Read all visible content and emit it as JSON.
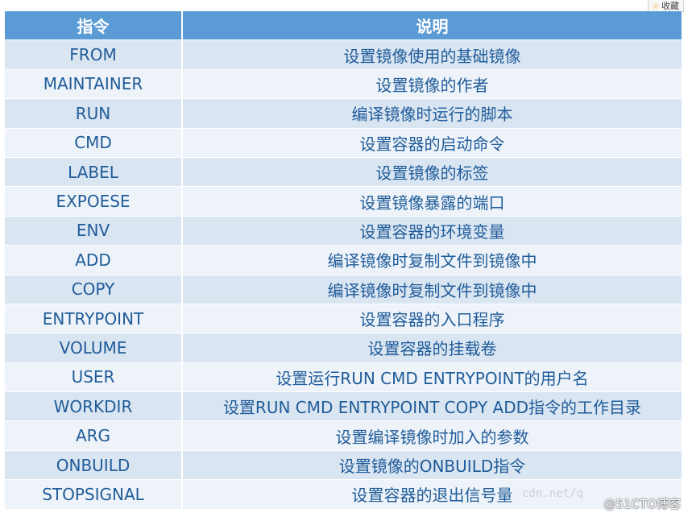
{
  "favorite": {
    "label": "收藏",
    "icon": "star-icon"
  },
  "table": {
    "headers": [
      "指令",
      "说明"
    ],
    "rows": [
      [
        "FROM",
        "设置镜像使用的基础镜像"
      ],
      [
        "MAINTAINER",
        "设置镜像的作者"
      ],
      [
        "RUN",
        "编译镜像时运行的脚本"
      ],
      [
        "CMD",
        "设置容器的启动命令"
      ],
      [
        "LABEL",
        "设置镜像的标签"
      ],
      [
        "EXPOESE",
        "设置镜像暴露的端口"
      ],
      [
        "ENV",
        "设置容器的环境变量"
      ],
      [
        "ADD",
        "编译镜像时复制文件到镜像中"
      ],
      [
        "COPY",
        "编译镜像时复制文件到镜像中"
      ],
      [
        "ENTRYPOINT",
        "设置容器的入口程序"
      ],
      [
        "VOLUME",
        "设置容器的挂载卷"
      ],
      [
        "USER",
        "设置运行RUN CMD ENTRYPOINT的用户名"
      ],
      [
        "WORKDIR",
        "设置RUN CMD ENTRYPOINT COPY ADD指令的工作目录"
      ],
      [
        "ARG",
        "设置编译镜像时加入的参数"
      ],
      [
        "ONBUILD",
        "设置镜像的ONBUILD指令"
      ],
      [
        "STOPSIGNAL",
        "设置容器的退出信号量"
      ]
    ]
  },
  "watermark_faint": "cdn.net/q",
  "watermark": "@51CTO博客",
  "colors": {
    "header_bg": "#5b9bd5",
    "row_odd": "#dae5f2",
    "row_even": "#eef3f9",
    "text": "#1f5c99"
  }
}
